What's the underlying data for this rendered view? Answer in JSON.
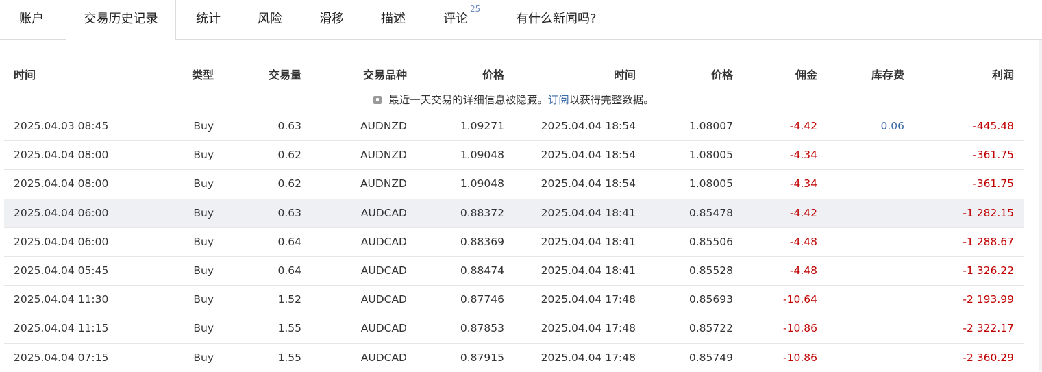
{
  "tabs": [
    {
      "label": "账户"
    },
    {
      "label": "交易历史记录",
      "active": true
    },
    {
      "label": "统计"
    },
    {
      "label": "风险"
    },
    {
      "label": "滑移"
    },
    {
      "label": "描述"
    },
    {
      "label": "评论",
      "badge": "25"
    },
    {
      "label": "有什么新闻吗?"
    }
  ],
  "table": {
    "headers": {
      "open_time": "时间",
      "type": "类型",
      "volume": "交易量",
      "symbol": "交易品种",
      "open_price": "价格",
      "close_time": "时间",
      "close_price": "价格",
      "commission": "佣金",
      "swap": "库存费",
      "profit": "利润"
    },
    "notice": {
      "before": "最近一天交易的详细信息被隐藏。",
      "link": "订阅",
      "after": "以获得完整数据。"
    },
    "rows": [
      {
        "open_time": "2025.04.03 08:45",
        "type": "Buy",
        "volume": "0.63",
        "symbol": "AUDNZD",
        "open_price": "1.09271",
        "close_time": "2025.04.04 18:54",
        "close_price": "1.08007",
        "commission": "-4.42",
        "swap": "0.06",
        "profit": "-445.48"
      },
      {
        "open_time": "2025.04.04 08:00",
        "type": "Buy",
        "volume": "0.62",
        "symbol": "AUDNZD",
        "open_price": "1.09048",
        "close_time": "2025.04.04 18:54",
        "close_price": "1.08005",
        "commission": "-4.34",
        "swap": "",
        "profit": "-361.75"
      },
      {
        "open_time": "2025.04.04 08:00",
        "type": "Buy",
        "volume": "0.62",
        "symbol": "AUDNZD",
        "open_price": "1.09048",
        "close_time": "2025.04.04 18:54",
        "close_price": "1.08005",
        "commission": "-4.34",
        "swap": "",
        "profit": "-361.75"
      },
      {
        "open_time": "2025.04.04 06:00",
        "type": "Buy",
        "volume": "0.63",
        "symbol": "AUDCAD",
        "open_price": "0.88372",
        "close_time": "2025.04.04 18:41",
        "close_price": "0.85478",
        "commission": "-4.42",
        "swap": "",
        "profit": "-1 282.15",
        "highlight": true
      },
      {
        "open_time": "2025.04.04 06:00",
        "type": "Buy",
        "volume": "0.64",
        "symbol": "AUDCAD",
        "open_price": "0.88369",
        "close_time": "2025.04.04 18:41",
        "close_price": "0.85506",
        "commission": "-4.48",
        "swap": "",
        "profit": "-1 288.67"
      },
      {
        "open_time": "2025.04.04 05:45",
        "type": "Buy",
        "volume": "0.64",
        "symbol": "AUDCAD",
        "open_price": "0.88474",
        "close_time": "2025.04.04 18:41",
        "close_price": "0.85528",
        "commission": "-4.48",
        "swap": "",
        "profit": "-1 326.22"
      },
      {
        "open_time": "2025.04.04 11:30",
        "type": "Buy",
        "volume": "1.52",
        "symbol": "AUDCAD",
        "open_price": "0.87746",
        "close_time": "2025.04.04 17:48",
        "close_price": "0.85693",
        "commission": "-10.64",
        "swap": "",
        "profit": "-2 193.99"
      },
      {
        "open_time": "2025.04.04 11:15",
        "type": "Buy",
        "volume": "1.55",
        "symbol": "AUDCAD",
        "open_price": "0.87853",
        "close_time": "2025.04.04 17:48",
        "close_price": "0.85722",
        "commission": "-10.86",
        "swap": "",
        "profit": "-2 322.17"
      },
      {
        "open_time": "2025.04.04 07:15",
        "type": "Buy",
        "volume": "1.55",
        "symbol": "AUDCAD",
        "open_price": "0.87915",
        "close_time": "2025.04.04 17:48",
        "close_price": "0.85749",
        "commission": "-10.86",
        "swap": "",
        "profit": "-2 360.29"
      }
    ]
  },
  "colors": {
    "negative": "#c00000",
    "link": "#3b6aa7",
    "highlight_row": "#eff0f4"
  }
}
